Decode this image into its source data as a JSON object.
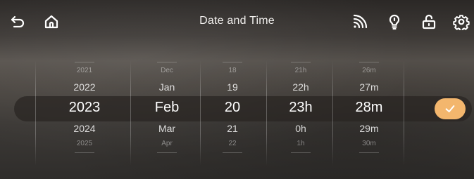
{
  "header": {
    "title": "Date and Time"
  },
  "icons": {
    "back": "back-arrow-icon",
    "home": "home-icon",
    "wifi": "wifi-icon",
    "bulb": "light-bulb-icon",
    "lock": "unlock-icon",
    "settings": "gear-icon",
    "confirm": "check-icon"
  },
  "colors": {
    "accent": "#f3b66d",
    "band": "#2a2623"
  },
  "picker": {
    "year": {
      "items": [
        "2021",
        "2022",
        "2023",
        "2024",
        "2025"
      ]
    },
    "month": {
      "items": [
        "Dec",
        "Jan",
        "Feb",
        "Mar",
        "Apr"
      ]
    },
    "day": {
      "items": [
        "18",
        "19",
        "20",
        "21",
        "22"
      ]
    },
    "hour": {
      "items": [
        "21h",
        "22h",
        "23h",
        "0h",
        "1h"
      ]
    },
    "minute": {
      "items": [
        "26m",
        "27m",
        "28m",
        "29m",
        "30m"
      ]
    }
  }
}
